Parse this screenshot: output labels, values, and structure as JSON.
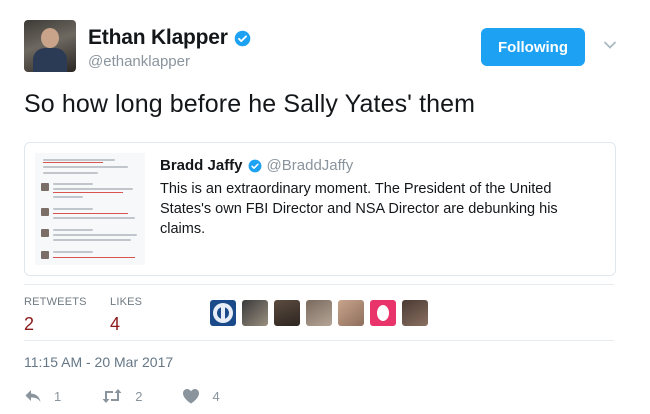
{
  "tweet": {
    "author": {
      "display_name": "Ethan Klapper",
      "handle": "@ethanklapper"
    },
    "follow_label": "Following",
    "text": "So how long before he Sally Yates' them",
    "quoted": {
      "display_name": "Bradd Jaffy",
      "handle": "@BraddJaffy",
      "text": "This is an extraordinary moment. The President of the United States's own FBI Director and NSA Director are debunking his claims."
    },
    "stats": {
      "retweets_label": "RETWEETS",
      "retweets": "2",
      "likes_label": "LIKES",
      "likes": "4"
    },
    "timestamp": "11:15 AM - 20 Mar 2017",
    "actions": {
      "reply_count": "1",
      "retweet_count": "2",
      "like_count": "4"
    }
  },
  "colors": {
    "accent": "#1da1f2",
    "stat_value": "#8b1a1a",
    "muted": "#8a949d"
  },
  "icons": [
    "verified-badge-icon",
    "chevron-down-icon",
    "reply-icon",
    "retweet-icon",
    "heart-icon"
  ]
}
